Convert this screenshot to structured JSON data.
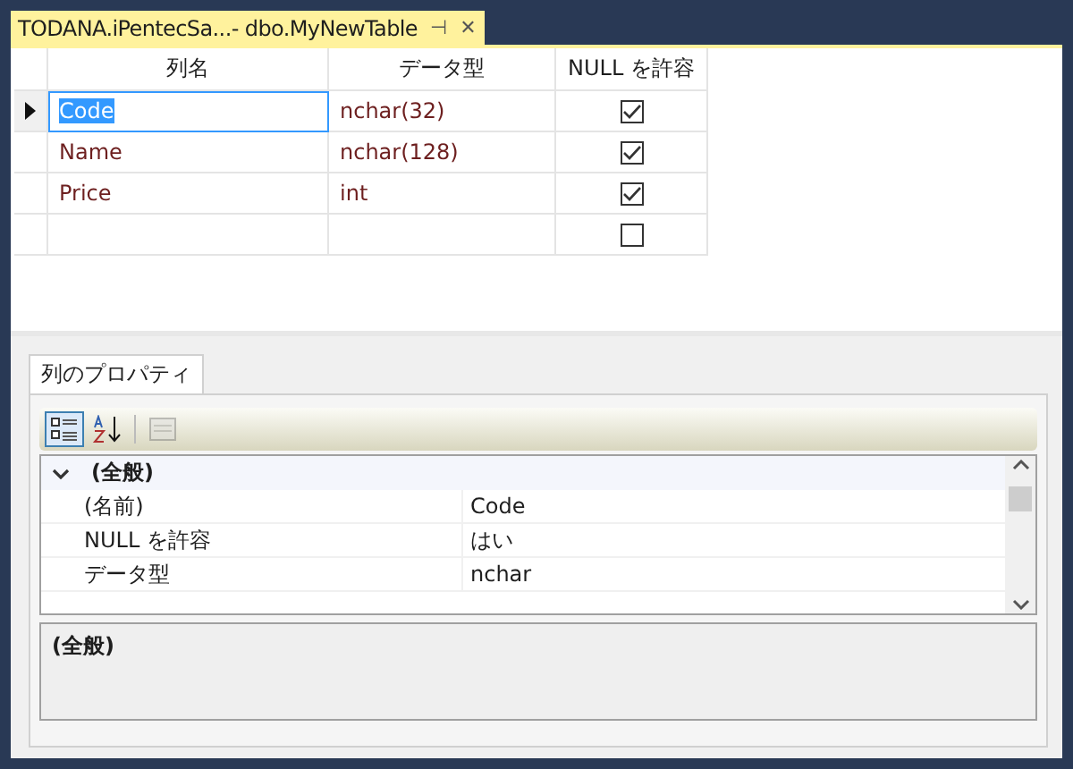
{
  "document_tab": {
    "title": "TODANA.iPentecSa...- dbo.MyNewTable",
    "pin": "⊣",
    "close": "✕"
  },
  "table": {
    "columns": [
      "列名",
      "データ型",
      "NULL を許容"
    ],
    "rows": [
      {
        "name": "Code",
        "type": "nchar(32)",
        "allow_null": true,
        "selected": true
      },
      {
        "name": "Name",
        "type": "nchar(128)",
        "allow_null": true,
        "selected": false
      },
      {
        "name": "Price",
        "type": "int",
        "allow_null": true,
        "selected": false
      },
      {
        "name": "",
        "type": "",
        "allow_null": false,
        "selected": false
      }
    ]
  },
  "properties_tab": {
    "label": "列のプロパティ"
  },
  "toolbar": [
    {
      "kind": "categorized",
      "selected": true
    },
    {
      "kind": "alphabetical",
      "selected": false
    },
    {
      "kind": "pages",
      "selected": false,
      "disabled": true
    }
  ],
  "property_grid": {
    "category": "(全般)",
    "expanded": true,
    "rows": [
      {
        "name": "(名前)",
        "value": "Code"
      },
      {
        "name": "NULL を許容",
        "value": "はい"
      },
      {
        "name": "データ型",
        "value": "nchar"
      }
    ]
  },
  "description": {
    "title": "(全般)"
  }
}
